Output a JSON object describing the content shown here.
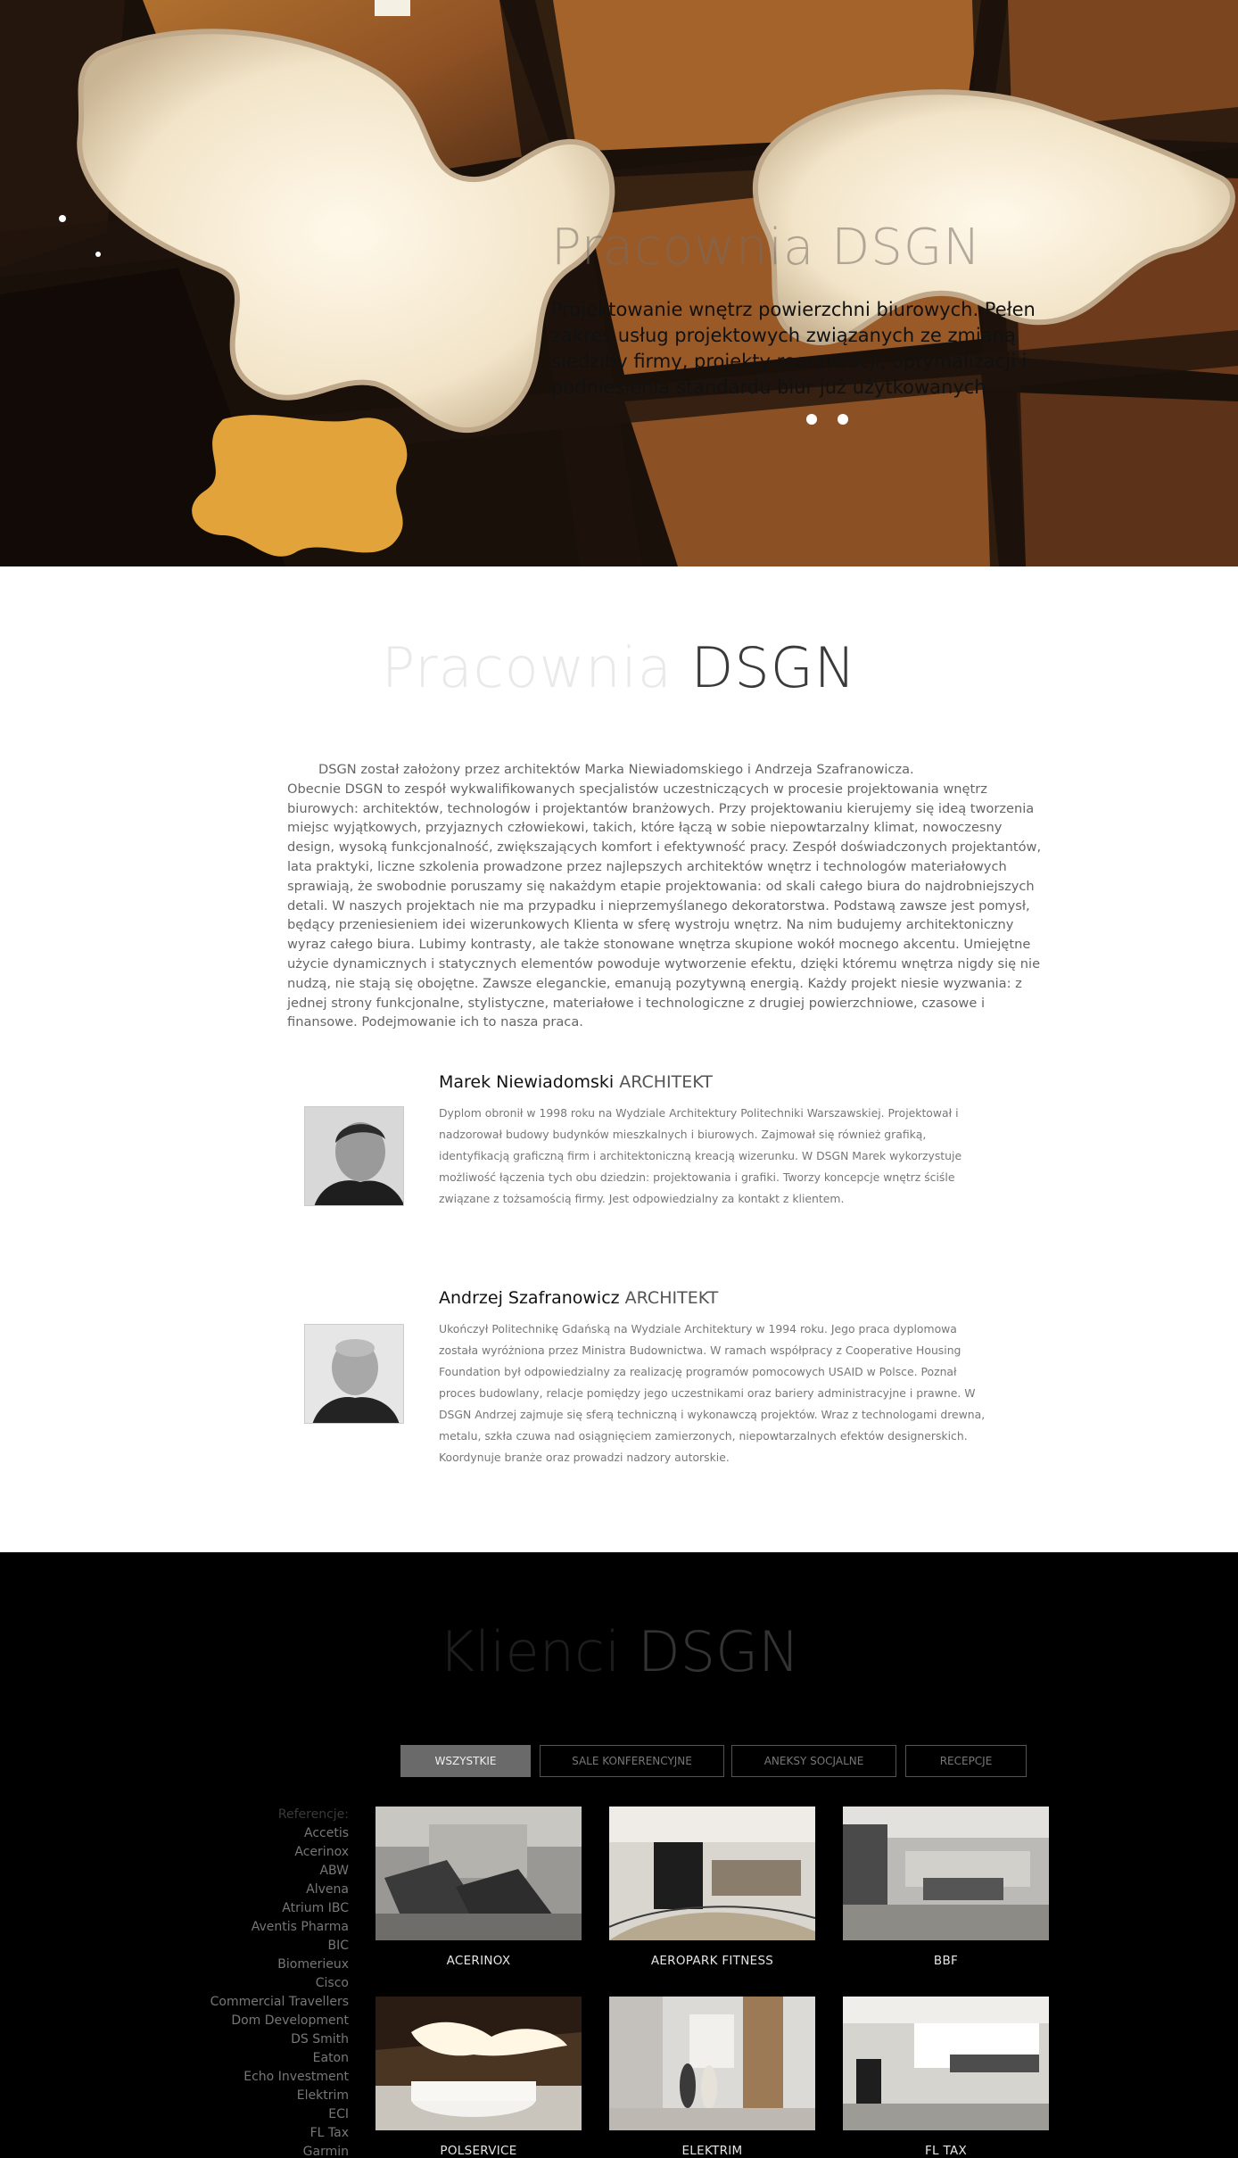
{
  "hero": {
    "title": "Pracownia DSGN",
    "description": "Projektowanie wnętrz powierzchni biurowych. Pełen zakres usług projektowych związanych ze zmianą siedziby firmy, projekty rearanżacji, optymalizacji i podniesienia standardu biur już użytkowanych."
  },
  "about": {
    "title_light": "Pracownia",
    "title_dark": "DSGN",
    "intro": "DSGN został założony przez architektów Marka Niewiadomskiego i Andrzeja Szafranowicza.",
    "body": "Obecnie DSGN to zespół wykwalifikowanych specjalistów uczestniczących w procesie projektowania wnętrz biurowych: architektów, technologów i projektantów branżowych. Przy projektowaniu kierujemy się ideą tworzenia miejsc wyjątkowych, przyjaznych człowiekowi, takich, które łączą w sobie niepowtarzalny klimat, nowoczesny design, wysoką funkcjonalność, zwiększających komfort i efektywność pracy. Zespół doświadczonych projektantów, lata praktyki, liczne szkolenia prowadzone przez najlepszych architektów wnętrz i technologów materiałowych sprawiają, że swobodnie poruszamy się nakażdym etapie projektowania: od skali całego biura do najdrobniejszych detali. W naszych projektach nie ma przypadku i nieprzemyślanego dekoratorstwa. Podstawą zawsze jest pomysł, będący przeniesieniem idei wizerunkowych Klienta w sferę wystroju wnętrz. Na nim budujemy architektoniczny wyraz całego biura. Lubimy kontrasty, ale także stonowane wnętrza skupione wokół mocnego akcentu. Umiejętne użycie dynamicznych i statycznych elementów powoduje wytworzenie efektu, dzięki któremu wnętrza nigdy się nie nudzą, nie stają się obojętne. Zawsze eleganckie, emanują pozytywną energią. Każdy projekt niesie wyzwania: z jednej strony funkcjonalne, stylistyczne, materiałowe i technologiczne z drugiej powierzchniowe, czasowe i finansowe. Podejmowanie ich to nasza praca."
  },
  "team": [
    {
      "name": "Marek Niewiadomski",
      "role": "ARCHITEKT",
      "bio": "Dyplom obronił w 1998 roku na Wydziale Architektury Politechniki Warszawskiej. Projektował i nadzorował budowy budynków mieszkalnych i biurowych. Zajmował się również grafiką, identyfikacją graficzną firm i architektoniczną kreacją wizerunku. W DSGN Marek wykorzystuje możliwość łączenia tych obu dziedzin: projektowania i grafiki. Tworzy koncepcje wnętrz ściśle związane z tożsamością firmy. Jest odpowiedzialny za kontakt z klientem."
    },
    {
      "name": "Andrzej Szafranowicz",
      "role": "ARCHITEKT",
      "bio": "Ukończył Politechnikę Gdańską na Wydziale Architektury w 1994 roku. Jego praca dyplomowa została wyróżniona przez Ministra Budownictwa. W ramach współpracy z Cooperative Housing Foundation był odpowiedzialny za realizację programów pomocowych USAID w Polsce. Poznał proces budowlany, relacje pomiędzy jego uczestnikami oraz bariery administracyjne i prawne. W DSGN Andrzej zajmuje się sferą techniczną i wykonawczą projektów. Wraz z technologami drewna, metalu, szkła czuwa nad osiągnięciem zamierzonych, niepowtarzalnych efektów designerskich. Koordynuje branże oraz prowadzi nadzory autorskie."
    }
  ],
  "clients": {
    "title_light": "Klienci",
    "title_dark": "DSGN",
    "filters": [
      "WSZYSTKIE",
      "SALE KONFERENCYJNE",
      "ANEKSY SOCJALNE",
      "RECEPCJE"
    ],
    "active_filter": "WSZYSTKIE",
    "references_label": "Referencje:",
    "references": [
      "Accetis",
      "Acerinox",
      "ABW",
      "Alvena",
      "Atrium IBC",
      "Aventis Pharma",
      "BIC",
      "Biomerieux",
      "Cisco",
      "Commercial Travellers",
      "Dom Development",
      "DS Smith",
      "Eaton",
      "Echo Investment",
      "Elektrim",
      "ECI",
      "FL Tax",
      "Garmin"
    ],
    "projects": [
      "ACERINOX",
      "AEROPARK FITNESS",
      "BBF",
      "POLSERVICE",
      "ELEKTRIM",
      "FL TAX"
    ]
  },
  "colors": {
    "clients_bg": "#000000",
    "active_filter_bg": "#6a6a6a",
    "hero_wood": "#8a5226"
  }
}
